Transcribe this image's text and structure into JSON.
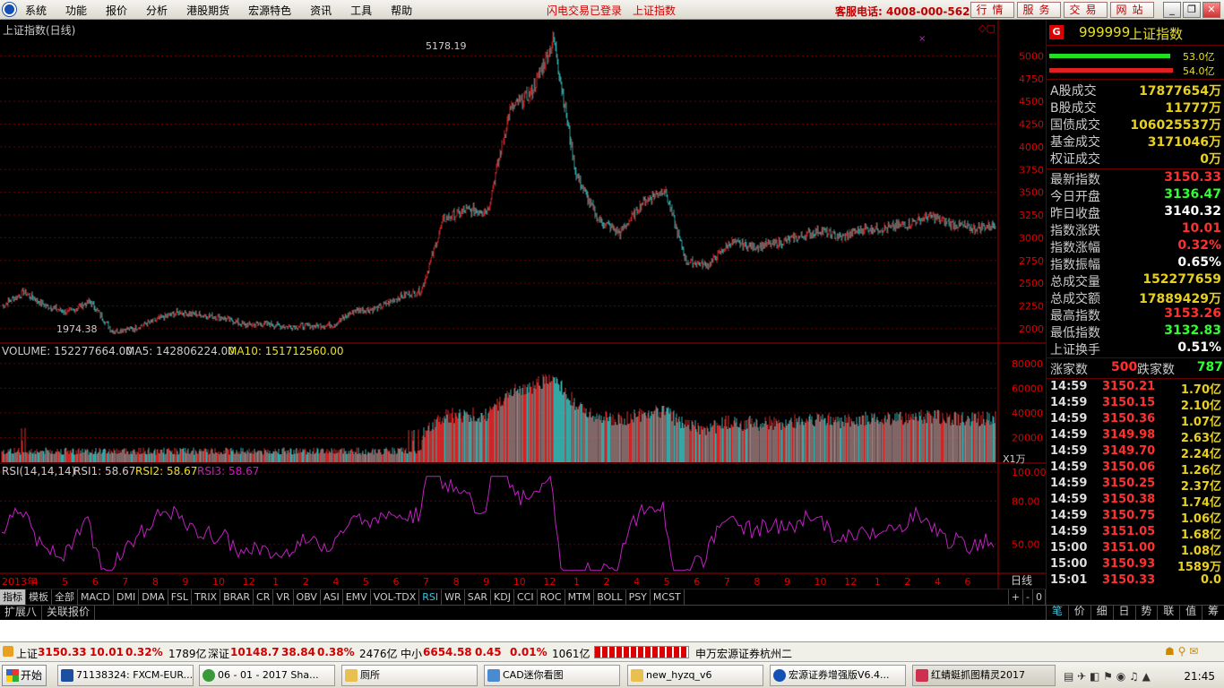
{
  "menubar": {
    "items": [
      "系统",
      "功能",
      "报价",
      "分析",
      "港股期货",
      "宏源特色",
      "资讯",
      "工具",
      "帮助"
    ],
    "notice": "闪电交易已登录",
    "index_name": "上证指数",
    "hotline": "客服电话: 4008-000-562",
    "buttons": [
      "行情",
      "服务",
      "交易",
      "网站"
    ]
  },
  "chart": {
    "title": "上证指数(日线)",
    "high_label": "5178.19",
    "low_label": "1974.38",
    "price_ticks": [
      "5000",
      "4750",
      "4500",
      "4250",
      "4000",
      "3750",
      "3500",
      "3250",
      "3000",
      "2750",
      "2500",
      "2250",
      "2000"
    ],
    "volume_title": "VOLUME: 152277664.00",
    "ma5": "MA5: 142806224.00",
    "ma10": "MA10: 151712560.00",
    "volume_ticks": [
      "80000",
      "60000",
      "40000",
      "20000"
    ],
    "volume_unit": "X1万",
    "rsi_title": "RSI(14,14,14)",
    "rsi1": "RSI1: 58.67",
    "rsi2": "RSI2: 58.67",
    "rsi3": "RSI3: 58.67",
    "rsi_ticks": [
      "100.00",
      "80.00",
      "50.00"
    ],
    "x_labels": [
      "2013年",
      "4",
      "5",
      "6",
      "7",
      "8",
      "9",
      "10",
      "12",
      "1",
      "2",
      "4",
      "5",
      "6",
      "7",
      "8",
      "9",
      "10",
      "12",
      "1",
      "2",
      "4",
      "5",
      "6",
      "7",
      "8",
      "9",
      "10",
      "12",
      "1",
      "2",
      "4",
      "6"
    ],
    "period": "日线",
    "zoom_btns": [
      "+",
      "-",
      "0"
    ]
  },
  "chart_data": {
    "type": "candlestick",
    "title": "上证指数(日线)",
    "price_range": [
      1900,
      5300
    ],
    "series_close": [
      [
        "2013-01",
        2250
      ],
      [
        "2013-02",
        2400
      ],
      [
        "2013-03",
        2250
      ],
      [
        "2013-04",
        2180
      ],
      [
        "2013-05",
        2300
      ],
      [
        "2013-06",
        1974
      ],
      [
        "2013-07",
        2000
      ],
      [
        "2013-08",
        2100
      ],
      [
        "2013-09",
        2180
      ],
      [
        "2013-10",
        2150
      ],
      [
        "2013-12",
        2120
      ],
      [
        "2014-01",
        2040
      ],
      [
        "2014-02",
        2050
      ],
      [
        "2014-04",
        2020
      ],
      [
        "2014-05",
        2030
      ],
      [
        "2014-06",
        2040
      ],
      [
        "2014-07",
        2200
      ],
      [
        "2014-08",
        2220
      ],
      [
        "2014-09",
        2350
      ],
      [
        "2014-10",
        2420
      ],
      [
        "2014-12",
        3200
      ],
      [
        "2015-01",
        3300
      ],
      [
        "2015-02",
        3300
      ],
      [
        "2015-04",
        4400
      ],
      [
        "2015-05",
        4600
      ],
      [
        "2015-06",
        5178
      ],
      [
        "2015-07",
        3700
      ],
      [
        "2015-08",
        3200
      ],
      [
        "2015-09",
        3050
      ],
      [
        "2015-10",
        3380
      ],
      [
        "2015-12",
        3540
      ],
      [
        "2016-01",
        2740
      ],
      [
        "2016-02",
        2700
      ],
      [
        "2016-04",
        2950
      ],
      [
        "2016-05",
        2900
      ],
      [
        "2016-06",
        2930
      ],
      [
        "2016-07",
        3000
      ],
      [
        "2016-08",
        3080
      ],
      [
        "2016-09",
        3000
      ],
      [
        "2016-10",
        3100
      ],
      [
        "2016-12",
        3100
      ],
      [
        "2017-01",
        3150
      ],
      [
        "2017-02",
        3240
      ],
      [
        "2017-04",
        3150
      ],
      [
        "2017-05",
        3100
      ],
      [
        "2017-06",
        3150
      ]
    ],
    "volume_range": [
      0,
      90000
    ],
    "rsi_range": [
      30,
      100
    ]
  },
  "right": {
    "code": "999999",
    "name": "上证指数",
    "icon": "G",
    "bar1": "53.0亿",
    "bar2": "54.0亿",
    "rows1": [
      {
        "label": "A股成交",
        "value": "17877654万",
        "color": "#e8d020"
      },
      {
        "label": "B股成交",
        "value": "11777万",
        "color": "#e8d020"
      },
      {
        "label": "国债成交",
        "value": "106025537万",
        "color": "#e8d020"
      },
      {
        "label": "基金成交",
        "value": "3171046万",
        "color": "#e8d020"
      },
      {
        "label": "权证成交",
        "value": "0万",
        "color": "#e8d020"
      }
    ],
    "rows2": [
      {
        "label": "最新指数",
        "value": "3150.33",
        "color": "#ff3030"
      },
      {
        "label": "今日开盘",
        "value": "3136.47",
        "color": "#30ff30"
      },
      {
        "label": "昨日收盘",
        "value": "3140.32",
        "color": "#ffffff"
      },
      {
        "label": "指数涨跌",
        "value": "10.01",
        "color": "#ff3030"
      },
      {
        "label": "指数涨幅",
        "value": "0.32%",
        "color": "#ff3030"
      },
      {
        "label": "指数振幅",
        "value": "0.65%",
        "color": "#ffffff"
      },
      {
        "label": "总成交量",
        "value": "152277659",
        "color": "#e8d020"
      },
      {
        "label": "总成交额",
        "value": "17889429万",
        "color": "#e8d020"
      },
      {
        "label": "最高指数",
        "value": "3153.26",
        "color": "#ff3030"
      },
      {
        "label": "最低指数",
        "value": "3132.83",
        "color": "#30ff30"
      },
      {
        "label": "上证换手",
        "value": "0.51%",
        "color": "#ffffff"
      }
    ],
    "up_label": "涨家数",
    "up_value": "500",
    "down_label": "跌家数",
    "down_value": "787",
    "ticks": [
      {
        "t": "14:59",
        "p": "3150.21",
        "q": "1.70亿"
      },
      {
        "t": "14:59",
        "p": "3150.15",
        "q": "2.10亿"
      },
      {
        "t": "14:59",
        "p": "3150.36",
        "q": "1.07亿"
      },
      {
        "t": "14:59",
        "p": "3149.98",
        "q": "2.63亿"
      },
      {
        "t": "14:59",
        "p": "3149.70",
        "q": "2.24亿"
      },
      {
        "t": "14:59",
        "p": "3150.06",
        "q": "1.26亿"
      },
      {
        "t": "14:59",
        "p": "3150.25",
        "q": "2.37亿"
      },
      {
        "t": "14:59",
        "p": "3150.38",
        "q": "1.74亿"
      },
      {
        "t": "14:59",
        "p": "3150.75",
        "q": "1.06亿"
      },
      {
        "t": "14:59",
        "p": "3151.05",
        "q": "1.68亿"
      },
      {
        "t": "15:00",
        "p": "3151.00",
        "q": "1.08亿"
      },
      {
        "t": "15:00",
        "p": "3150.93",
        "q": "1589万"
      },
      {
        "t": "15:01",
        "p": "3150.33",
        "q": "0.0"
      }
    ],
    "tabs": [
      "笔",
      "价",
      "细",
      "日",
      "势",
      "联",
      "值",
      "筹"
    ]
  },
  "indicators": [
    "指标",
    "模板",
    "全部",
    "MACD",
    "DMI",
    "DMA",
    "FSL",
    "TRIX",
    "BRAR",
    "CR",
    "VR",
    "OBV",
    "ASI",
    "EMV",
    "VOL-TDX",
    "RSI",
    "WR",
    "SAR",
    "KDJ",
    "CCI",
    "ROC",
    "MTM",
    "BOLL",
    "PSY",
    "MCST"
  ],
  "ext_tabs": [
    "扩展八",
    "关联报价"
  ],
  "status": {
    "sh_label": "上证",
    "sh_val": "3150.33",
    "sh_chg": "10.01",
    "sh_pct": "0.32%",
    "sh_amt": "1789亿",
    "sz_label": "深证",
    "sz_val": "10148.7",
    "sz_chg": "38.84",
    "sz_pct": "0.38%",
    "sz_amt": "2476亿",
    "zx_label": "中小",
    "zx_val": "6654.58",
    "zx_chg": "0.45",
    "zx_pct": "0.01%",
    "zx_amt": "1061亿",
    "broker": "申万宏源证券杭州二"
  },
  "taskbar": {
    "start": "开始",
    "tasks": [
      "71138324: FXCM-EUR...",
      "06 - 01 - 2017 Sha...",
      "厕所",
      "CAD迷你看图",
      "new_hyzq_v6",
      "宏源证券增强版V6.4...",
      "红蜻蜓抓图精灵2017"
    ],
    "clock": "21:45"
  }
}
